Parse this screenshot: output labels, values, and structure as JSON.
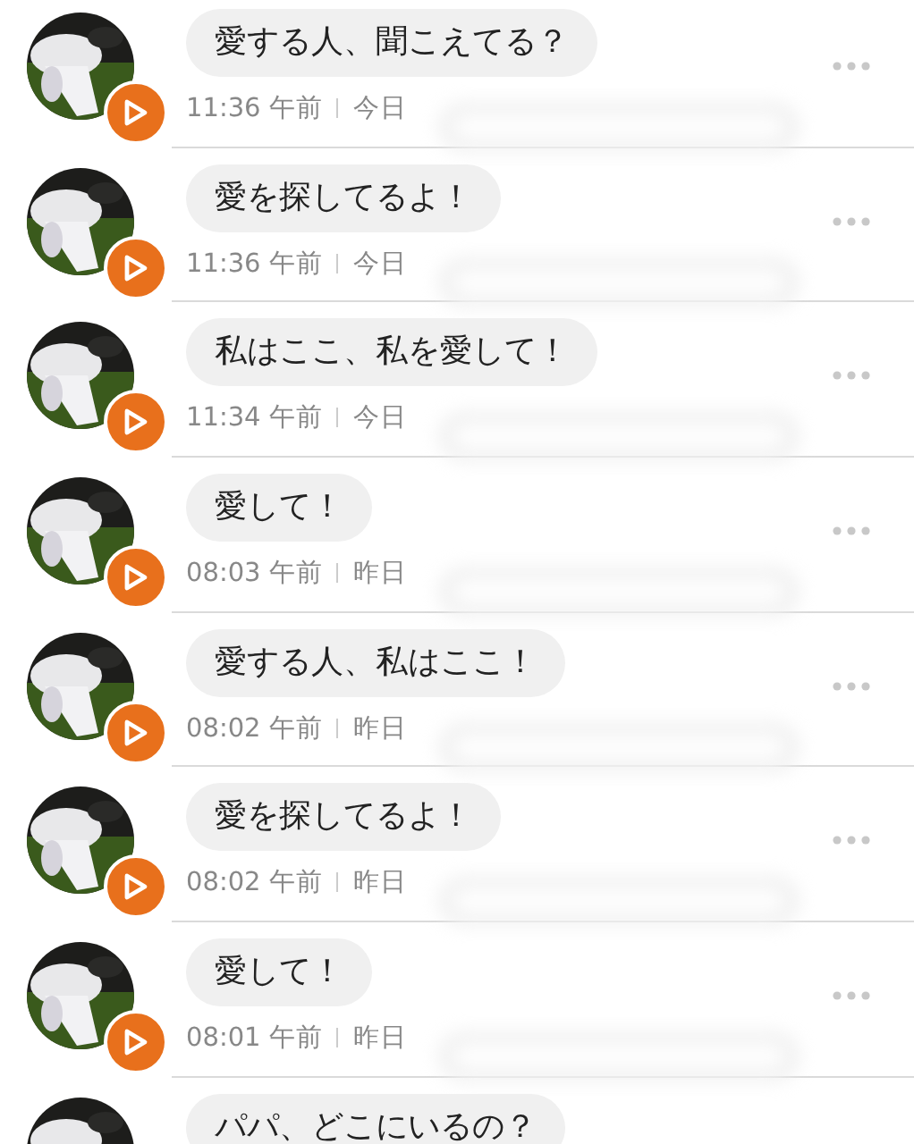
{
  "messages": [
    {
      "text": "愛する人、聞こえてる？",
      "time": "11:36 午前",
      "day": "今日"
    },
    {
      "text": "愛を探してるよ！",
      "time": "11:36 午前",
      "day": "今日"
    },
    {
      "text": "私はここ、私を愛して！",
      "time": "11:34 午前",
      "day": "今日"
    },
    {
      "text": "愛して！",
      "time": "08:03 午前",
      "day": "昨日"
    },
    {
      "text": "愛する人、私はここ！",
      "time": "08:02 午前",
      "day": "昨日"
    },
    {
      "text": "愛を探してるよ！",
      "time": "08:02 午前",
      "day": "昨日"
    },
    {
      "text": "愛して！",
      "time": "08:01 午前",
      "day": "昨日"
    },
    {
      "text": "パパ、どこにいるの？"
    }
  ]
}
